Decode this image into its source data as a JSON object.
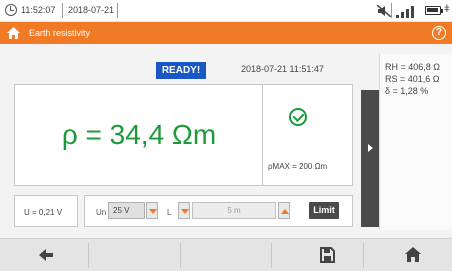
{
  "status": {
    "time": "11:52:07",
    "date": "2018-07-21",
    "battery_percent": "100%",
    "icons": [
      "clock-icon",
      "mute-icon",
      "signal-icon",
      "battery-icon",
      "plug-icon"
    ]
  },
  "header": {
    "title": "Earth resistivity",
    "home_icon": "home-icon",
    "help_icon": "help-icon",
    "help_symbol": "?",
    "accent_color": "#f07a26"
  },
  "measurement": {
    "state": "READY!",
    "timestamp": "2018-07-21 11:51:47",
    "result": "ρ = 34,4 Ωm",
    "result_color": "#1c9a3a",
    "ok_icon": "check-circle-icon",
    "pmax_label": "ρMAX = 200 Ωm"
  },
  "side_panel": {
    "rh": "RH = 406,8 Ω",
    "rs": "RS = 401,6 Ω",
    "delta": "δ  = 1,28 %"
  },
  "controls": {
    "u_value": "U = 0,21 V",
    "un_label": "Un",
    "un_value": "25 V",
    "l_label": "L",
    "l_value": "5 m",
    "limit_label": "Limit"
  },
  "toolbar": {
    "icons": [
      "back-arrow-icon",
      "save-icon",
      "home-icon"
    ]
  }
}
